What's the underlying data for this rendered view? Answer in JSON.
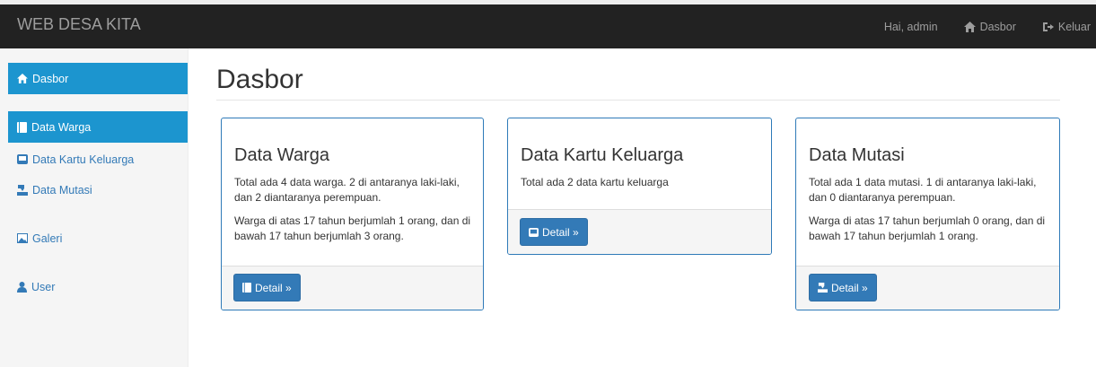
{
  "navbar": {
    "brand": "WEB DESA KITA",
    "greeting": "Hai, admin",
    "dashboard_label": "Dasbor",
    "logout_label": "Keluar"
  },
  "sidebar": {
    "items": [
      {
        "label": "Dasbor",
        "icon": "home-icon",
        "active": true
      },
      {
        "label": "Data Warga",
        "icon": "book-icon",
        "active": true
      },
      {
        "label": "Data Kartu Keluarga",
        "icon": "card-icon",
        "active": false
      },
      {
        "label": "Data Mutasi",
        "icon": "transfer-icon",
        "active": false
      },
      {
        "label": "Galeri",
        "icon": "picture-icon",
        "active": false
      },
      {
        "label": "User",
        "icon": "user-icon",
        "active": false
      }
    ]
  },
  "page": {
    "title": "Dasbor"
  },
  "cards": {
    "warga": {
      "title": "Data Warga",
      "text1": "Total ada 4 data warga. 2 di antaranya laki-laki, dan 2 diantaranya perempuan.",
      "text2": "Warga di atas 17 tahun berjumlah 1 orang, dan di bawah 17 tahun berjumlah 3 orang.",
      "button": "Detail »"
    },
    "kk": {
      "title": "Data Kartu Keluarga",
      "text1": "Total ada 2 data kartu keluarga",
      "button": "Detail »"
    },
    "mutasi": {
      "title": "Data Mutasi",
      "text1": "Total ada 1 data mutasi. 1 di antaranya laki-laki, dan 0 diantaranya perempuan.",
      "text2": "Warga di atas 17 tahun berjumlah 0 orang, dan di bawah 17 tahun berjumlah 1 orang.",
      "button": "Detail »"
    }
  },
  "colors": {
    "navbar_bg": "#222222",
    "primary": "#337ab7",
    "sidebar_active": "#1c95cf"
  }
}
